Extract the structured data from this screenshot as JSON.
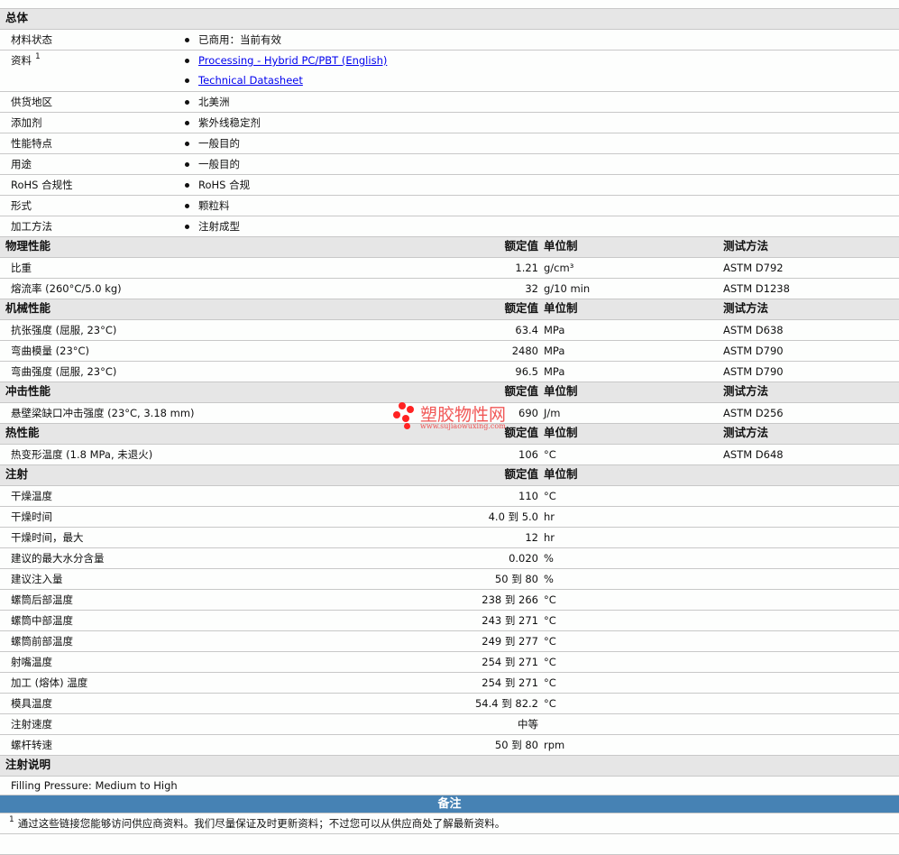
{
  "general": {
    "title": "总体",
    "rows": [
      {
        "label": "材料状态",
        "items": [
          "已商用：当前有效"
        ]
      },
      {
        "label": "资料",
        "sup": "1",
        "links": [
          "Processing - Hybrid PC/PBT (English)",
          "Technical Datasheet"
        ]
      },
      {
        "label": "供货地区",
        "items": [
          "北美洲"
        ]
      },
      {
        "label": "添加剂",
        "items": [
          "紫外线稳定剂"
        ]
      },
      {
        "label": "性能特点",
        "items": [
          "一般目的"
        ]
      },
      {
        "label": "用途",
        "items": [
          "一般目的"
        ]
      },
      {
        "label": "RoHS 合规性",
        "items": [
          "RoHS 合规"
        ]
      },
      {
        "label": "形式",
        "items": [
          "颗粒料"
        ]
      },
      {
        "label": "加工方法",
        "items": [
          "注射成型"
        ]
      }
    ]
  },
  "sections": [
    {
      "title": "物理性能",
      "h_value": "额定值",
      "h_unit": "单位制",
      "h_method": "测试方法",
      "rows": [
        {
          "label": "比重",
          "value": "1.21",
          "unit": "g/cm³",
          "method": "ASTM D792"
        },
        {
          "label": "熔流率 (260°C/5.0 kg)",
          "value": "32",
          "unit": "g/10 min",
          "method": "ASTM D1238"
        }
      ]
    },
    {
      "title": "机械性能",
      "h_value": "额定值",
      "h_unit": "单位制",
      "h_method": "测试方法",
      "rows": [
        {
          "label": "抗张强度 (屈服, 23°C)",
          "value": "63.4",
          "unit": "MPa",
          "method": "ASTM D638"
        },
        {
          "label": "弯曲模量 (23°C)",
          "value": "2480",
          "unit": "MPa",
          "method": "ASTM D790"
        },
        {
          "label": "弯曲强度 (屈服, 23°C)",
          "value": "96.5",
          "unit": "MPa",
          "method": "ASTM D790"
        }
      ]
    },
    {
      "title": "冲击性能",
      "h_value": "额定值",
      "h_unit": "单位制",
      "h_method": "测试方法",
      "rows": [
        {
          "label": "悬壁梁缺口冲击强度 (23°C, 3.18 mm)",
          "value": "690",
          "unit": "J/m",
          "method": "ASTM D256"
        }
      ]
    },
    {
      "title": "热性能",
      "h_value": "额定值",
      "h_unit": "单位制",
      "h_method": "测试方法",
      "rows": [
        {
          "label": "热变形温度 (1.8 MPa, 未退火)",
          "value": "106",
          "unit": "°C",
          "method": "ASTM D648"
        }
      ]
    },
    {
      "title": "注射",
      "h_value": "额定值",
      "h_unit": "单位制",
      "h_method": "",
      "rows": [
        {
          "label": "干燥温度",
          "value": "110",
          "unit": "°C",
          "method": ""
        },
        {
          "label": "干燥时间",
          "value": "4.0 到 5.0",
          "unit": "hr",
          "method": ""
        },
        {
          "label": "干燥时间，最大",
          "value": "12",
          "unit": "hr",
          "method": ""
        },
        {
          "label": "建议的最大水分含量",
          "value": "0.020",
          "unit": "%",
          "method": ""
        },
        {
          "label": "建议注入量",
          "value": "50 到 80",
          "unit": "%",
          "method": ""
        },
        {
          "label": "螺筒后部温度",
          "value": "238 到 266",
          "unit": "°C",
          "method": ""
        },
        {
          "label": "螺筒中部温度",
          "value": "243 到 271",
          "unit": "°C",
          "method": ""
        },
        {
          "label": "螺筒前部温度",
          "value": "249 到 277",
          "unit": "°C",
          "method": ""
        },
        {
          "label": "射嘴温度",
          "value": "254 到 271",
          "unit": "°C",
          "method": ""
        },
        {
          "label": "加工 (熔体) 温度",
          "value": "254 到 271",
          "unit": "°C",
          "method": ""
        },
        {
          "label": "模具温度",
          "value": "54.4 到 82.2",
          "unit": "°C",
          "method": ""
        },
        {
          "label": "注射速度",
          "value": "中等",
          "unit": "",
          "method": ""
        },
        {
          "label": "螺杆转速",
          "value": "50 到 80",
          "unit": "rpm",
          "method": ""
        }
      ]
    }
  ],
  "injection_notes": {
    "title": "注射说明",
    "text": "Filling Pressure: Medium to High"
  },
  "notes": {
    "title": "备注",
    "sup": "1",
    "text": "通过这些链接您能够访问供应商资料。我们尽量保证及时更新资料；不过您可以从供应商处了解最新资料。"
  },
  "watermark": {
    "name": "塑胶物性网",
    "url": "www.sujiaowuxing.com"
  },
  "colors": {
    "section_bg": "#e6e6e6",
    "notes_bg": "#4682b4",
    "link": "#0000ee"
  }
}
